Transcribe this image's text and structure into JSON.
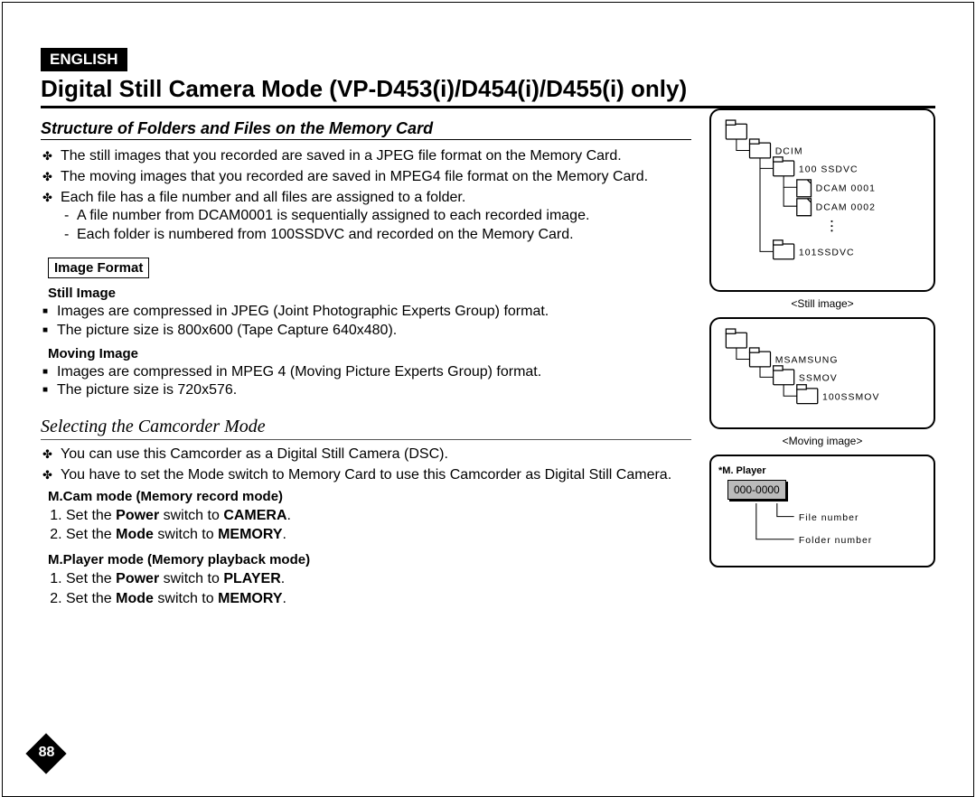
{
  "lang": "ENGLISH",
  "title": "Digital Still Camera Mode (VP-D453(i)/D454(i)/D455(i) only)",
  "section1_heading": "Structure of Folders and Files on the Memory Card",
  "s1_b1": "The still images that you recorded are saved in a JPEG file format on the Memory Card.",
  "s1_b2": "The moving images that you recorded are saved in MPEG4 file format on the Memory Card.",
  "s1_b3": "Each file has a file number and all files are assigned to a folder.",
  "s1_b3_d1": "A file number from DCAM0001 is sequentially assigned to each recorded image.",
  "s1_b3_d2": "Each folder is numbered from 100SSDVC and recorded on the Memory Card.",
  "image_format_label": "Image Format",
  "still_image_label": "Still Image",
  "still_b1": "Images are compressed in JPEG (Joint Photographic Experts Group) format.",
  "still_b2": "The picture size is 800x600 (Tape Capture 640x480).",
  "moving_image_label": "Moving Image",
  "mov_b1": "Images are compressed in MPEG 4 (Moving Picture Experts Group) format.",
  "mov_b2": "The picture size is 720x576.",
  "section2_heading": "Selecting the Camcorder Mode",
  "s2_b1": "You can use this Camcorder as a Digital Still Camera (DSC).",
  "s2_b2": "You have to set the Mode switch to Memory Card to use this Camcorder as Digital Still Camera.",
  "mcam_label": "M.Cam mode (Memory record mode)",
  "mcam_1_pre": "Set the ",
  "mcam_1_b1": "Power",
  "mcam_1_mid": " switch to ",
  "mcam_1_b2": "CAMERA",
  "mcam_2_pre": "Set the ",
  "mcam_2_b1": "Mode",
  "mcam_2_mid": " switch to ",
  "mcam_2_b2": "MEMORY",
  "mplayer_label": "M.Player mode (Memory playback mode)",
  "mpl_1_pre": "Set the ",
  "mpl_1_b1": "Power",
  "mpl_1_mid": " switch to ",
  "mpl_1_b2": "PLAYER",
  "mpl_2_pre": "Set the ",
  "mpl_2_b1": "Mode",
  "mpl_2_mid": " switch to ",
  "mpl_2_b2": "MEMORY",
  "page_number": "88",
  "diagram": {
    "still_caption": "<Still image>",
    "moving_caption": "<Moving image>",
    "dcim": "DCIM",
    "f100": "100 SSDVC",
    "dcam1": "DCAM 0001",
    "dcam2": "DCAM 0002",
    "f101": "101SSDVC",
    "msamsung": "MSAMSUNG",
    "ssmov": "SSMOV",
    "f100ssmov": "100SSMOV",
    "mplayer": "*M. Player",
    "zero": "000-0000",
    "filenum": "File number",
    "foldernum": "Folder number"
  }
}
